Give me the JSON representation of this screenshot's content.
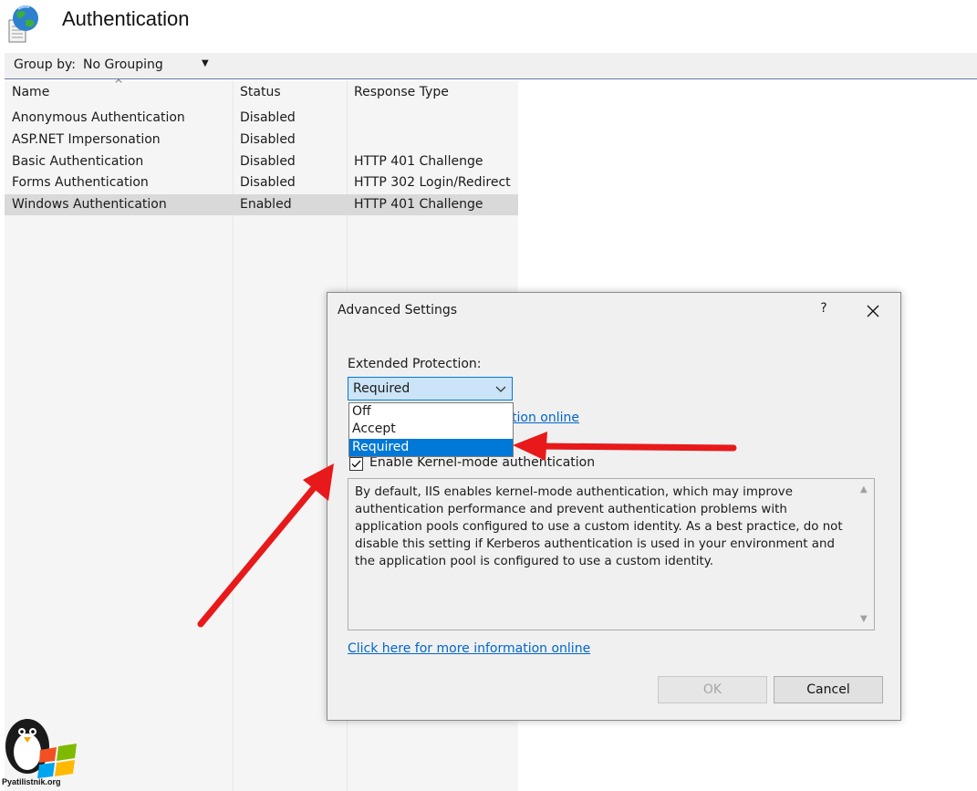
{
  "page": {
    "title": "Authentication",
    "app_icon": "iis-globe-document-icon"
  },
  "toolbar": {
    "group_by_label": "Group by:",
    "group_by_value": "No Grouping"
  },
  "table": {
    "columns": [
      "Name",
      "Status",
      "Response Type"
    ],
    "rows": [
      {
        "name": "Anonymous Authentication",
        "status": "Disabled",
        "response": ""
      },
      {
        "name": "ASP.NET Impersonation",
        "status": "Disabled",
        "response": ""
      },
      {
        "name": "Basic Authentication",
        "status": "Disabled",
        "response": "HTTP 401 Challenge"
      },
      {
        "name": "Forms Authentication",
        "status": "Disabled",
        "response": "HTTP 302 Login/Redirect"
      },
      {
        "name": "Windows Authentication",
        "status": "Enabled",
        "response": "HTTP 401 Challenge"
      }
    ],
    "selected_row": 4
  },
  "dialog": {
    "title": "Advanced Settings",
    "help": "?",
    "extended_protection_label": "Extended Protection:",
    "extended_protection_value": "Required",
    "options": [
      "Off",
      "Accept",
      "Required"
    ],
    "selected_option": "Required",
    "link_partial": "tion online",
    "kernel_mode_label": "Enable Kernel-mode authentication",
    "kernel_mode_checked": true,
    "description": "By default, IIS enables kernel-mode authentication, which may improve authentication performance and prevent authentication problems with application pools configured to use a custom identity. As a best practice, do not disable this setting if Kerberos authentication is used in your environment and the application pool is configured to use a custom identity.",
    "more_info_link": "Click here for more information online",
    "ok_label": "OK",
    "cancel_label": "Cancel"
  },
  "watermark": {
    "text": "Pyatilistnik.org"
  },
  "colors": {
    "selection_blue": "#0078d7",
    "combo_highlight": "#cce4f7",
    "link": "#0066cc",
    "annotation_red": "#e8191b",
    "selected_row": "#d9d9d9"
  }
}
